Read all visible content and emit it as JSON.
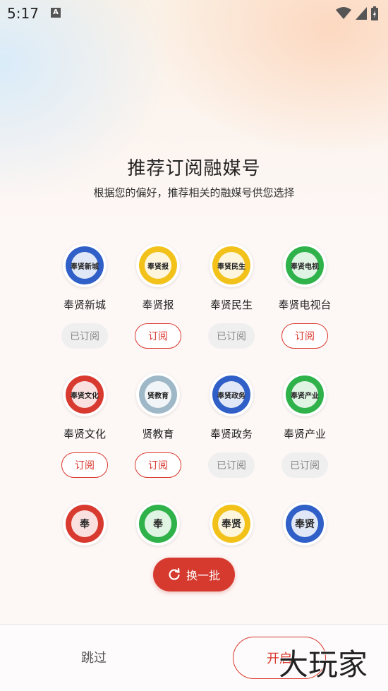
{
  "status_bar": {
    "time": "5:17",
    "notif_letter": "A"
  },
  "header": {
    "title": "推荐订阅融媒号",
    "subtitle": "根据您的偏好，推荐相关的融媒号供您选择"
  },
  "channels": [
    {
      "name": "奉贤新城",
      "button": "已订阅",
      "subscribed": true,
      "color": "#2f5fc7",
      "text": "奉贤新城"
    },
    {
      "name": "奉贤报",
      "button": "订阅",
      "subscribed": false,
      "color": "#f2c21b",
      "text": "奉贤报"
    },
    {
      "name": "奉贤民生",
      "button": "已订阅",
      "subscribed": true,
      "color": "#f2c21b",
      "text": "奉贤民生"
    },
    {
      "name": "奉贤电视台",
      "button": "订阅",
      "subscribed": false,
      "color": "#2fb24a",
      "text": "奉贤电视"
    },
    {
      "name": "奉贤文化",
      "button": "订阅",
      "subscribed": false,
      "color": "#d93a30",
      "text": "奉贤文化"
    },
    {
      "name": "贤教育",
      "button": "订阅",
      "subscribed": false,
      "color": "#9fb8c8",
      "text": "贤教育"
    },
    {
      "name": "奉贤政务",
      "button": "已订阅",
      "subscribed": true,
      "color": "#2f5fc7",
      "text": "奉贤政务"
    },
    {
      "name": "奉贤产业",
      "button": "已订阅",
      "subscribed": true,
      "color": "#2fb24a",
      "text": "奉贤产业"
    },
    {
      "name": "",
      "button": "",
      "subscribed": false,
      "color": "#d93a30",
      "text": "奉"
    },
    {
      "name": "",
      "button": "",
      "subscribed": false,
      "color": "#2fb24a",
      "text": "奉"
    },
    {
      "name": "",
      "button": "",
      "subscribed": false,
      "color": "#f2c21b",
      "text": "奉贤"
    },
    {
      "name": "",
      "button": "",
      "subscribed": false,
      "color": "#2f5fc7",
      "text": "奉贤"
    }
  ],
  "actions": {
    "refresh_label": "换一批",
    "skip_label": "跳过",
    "open_label": "开启"
  },
  "watermark": {
    "text": "大玩家"
  }
}
